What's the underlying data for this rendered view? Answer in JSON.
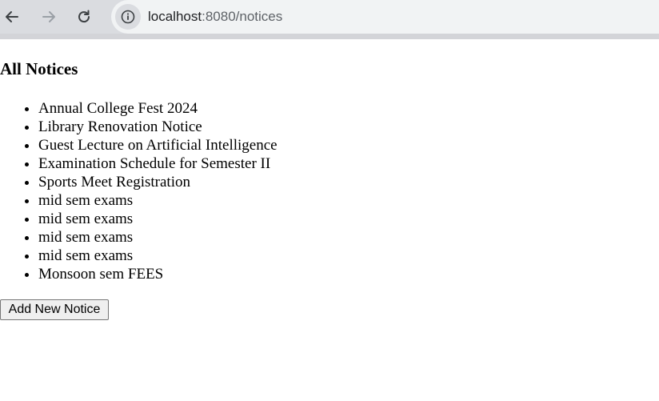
{
  "browser": {
    "url_host": "localhost",
    "url_rest": ":8080/notices",
    "icons": {
      "back": "arrow-left-icon",
      "forward": "arrow-right-icon",
      "reload": "reload-icon",
      "site_info": "info-icon"
    }
  },
  "page": {
    "title": "All Notices",
    "notices": [
      "Annual College Fest 2024",
      "Library Renovation Notice",
      "Guest Lecture on Artificial Intelligence",
      "Examination Schedule for Semester II",
      "Sports Meet Registration",
      "mid sem exams",
      "mid sem exams",
      "mid sem exams",
      "mid sem exams",
      "Monsoon sem FEES"
    ],
    "add_button_label": "Add New Notice"
  }
}
